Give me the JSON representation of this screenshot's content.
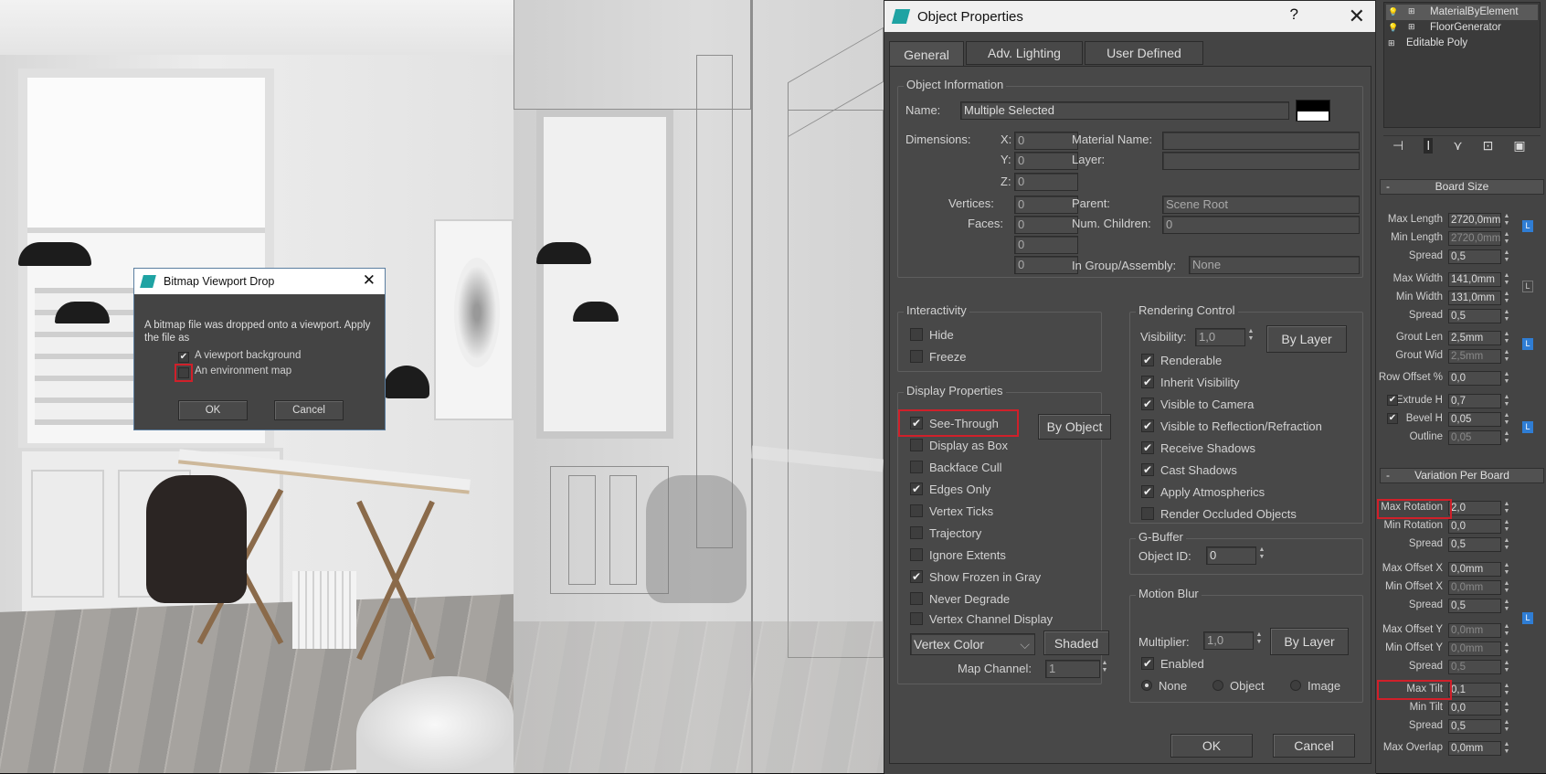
{
  "bitmap_dialog": {
    "title": "Bitmap Viewport Drop",
    "message": "A bitmap file was dropped onto a viewport. Apply the file as",
    "option_background": "A viewport background",
    "option_environment": "An environment map",
    "ok": "OK",
    "cancel": "Cancel"
  },
  "props": {
    "title": "Object Properties",
    "help": "?",
    "tabs": [
      "General",
      "Adv. Lighting",
      "User Defined"
    ],
    "object_info": {
      "group": "Object Information",
      "name_label": "Name:",
      "name_value": "Multiple Selected",
      "dimensions_label": "Dimensions:",
      "x": "X:",
      "y": "Y:",
      "z": "Z:",
      "x_val": "0",
      "y_val": "0",
      "z_val": "0",
      "vertices_label": "Vertices:",
      "vertices_val": "0",
      "faces_label": "Faces:",
      "faces_val": "0",
      "extra1": "0",
      "extra2": "0",
      "material_name_label": "Material Name:",
      "layer_label": "Layer:",
      "parent_label": "Parent:",
      "parent_val": "Scene Root",
      "num_children_label": "Num. Children:",
      "num_children_val": "0",
      "group_assembly_label": "In Group/Assembly:",
      "group_assembly_val": "None"
    },
    "interactivity": {
      "group": "Interactivity",
      "hide": "Hide",
      "freeze": "Freeze"
    },
    "display": {
      "group": "Display Properties",
      "by_object": "By Object",
      "items": [
        "See-Through",
        "Display as Box",
        "Backface Cull",
        "Edges Only",
        "Vertex Ticks",
        "Trajectory",
        "Ignore Extents",
        "Show Frozen in Gray",
        "Never Degrade",
        "Vertex Channel Display"
      ],
      "vertex_color": "Vertex Color",
      "shaded": "Shaded",
      "map_channel_label": "Map Channel:",
      "map_channel_val": "1"
    },
    "rendering": {
      "group": "Rendering Control",
      "visibility_label": "Visibility:",
      "visibility_val": "1,0",
      "by_layer": "By Layer",
      "items": [
        "Renderable",
        "Inherit Visibility",
        "Visible to Camera",
        "Visible to Reflection/Refraction",
        "Receive Shadows",
        "Cast Shadows",
        "Apply Atmospherics",
        "Render Occluded Objects"
      ]
    },
    "gbuffer": {
      "group": "G-Buffer",
      "object_id_label": "Object ID:",
      "object_id_val": "0"
    },
    "motion_blur": {
      "group": "Motion Blur",
      "multiplier_label": "Multiplier:",
      "multiplier_val": "1,0",
      "by_layer": "By Layer",
      "enabled": "Enabled",
      "none": "None",
      "object": "Object",
      "image": "Image"
    },
    "ok": "OK",
    "cancel": "Cancel"
  },
  "modifier_stack": [
    "MaterialByElement",
    "FloorGenerator",
    "Editable Poly"
  ],
  "board_size": {
    "header": "Board Size",
    "rows": [
      {
        "label": "Max Length",
        "value": "2720,0mm"
      },
      {
        "label": "Min Length",
        "value": "2720,0mm"
      },
      {
        "label": "Spread",
        "value": "0,5"
      },
      {
        "label": "Max Width",
        "value": "141,0mm"
      },
      {
        "label": "Min Width",
        "value": "131,0mm"
      },
      {
        "label": "Spread",
        "value": "0,5"
      },
      {
        "label": "Grout Len",
        "value": "2,5mm"
      },
      {
        "label": "Grout Wid",
        "value": "2,5mm"
      },
      {
        "label": "Row Offset %",
        "value": "0,0"
      },
      {
        "label": "Extrude H",
        "value": "0,7"
      },
      {
        "label": "Bevel   H",
        "value": "0,05"
      },
      {
        "label": "Outline",
        "value": "0,05"
      }
    ],
    "lock": "L"
  },
  "variation": {
    "header": "Variation Per Board",
    "rows": [
      {
        "label": "Max Rotation",
        "value": "2,0"
      },
      {
        "label": "Min Rotation",
        "value": "0,0"
      },
      {
        "label": "Spread",
        "value": "0,5"
      },
      {
        "label": "Max Offset X",
        "value": "0,0mm"
      },
      {
        "label": "Min Offset X",
        "value": "0,0mm"
      },
      {
        "label": "Spread",
        "value": "0,5"
      },
      {
        "label": "Max Offset Y",
        "value": "0,0mm"
      },
      {
        "label": "Min Offset Y",
        "value": "0,0mm"
      },
      {
        "label": "Spread",
        "value": "0,5"
      },
      {
        "label": "Max Tilt",
        "value": "0,1"
      },
      {
        "label": "Min Tilt",
        "value": "0,0"
      },
      {
        "label": "Spread",
        "value": "0,5"
      },
      {
        "label": "Max Overlap",
        "value": "0,0mm"
      }
    ]
  }
}
